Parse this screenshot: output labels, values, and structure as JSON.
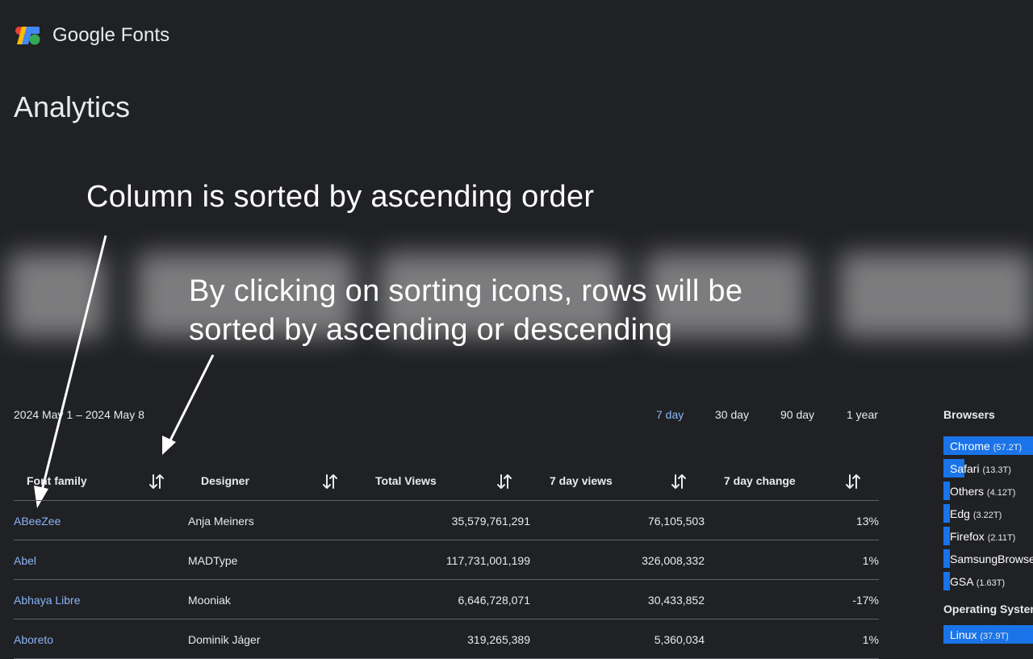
{
  "header": {
    "app_name": "Google Fonts"
  },
  "page": {
    "title": "Analytics"
  },
  "annotations": {
    "note1": "Column is sorted by ascending order",
    "note2": "By clicking on sorting icons, rows will be sorted by ascending or descending"
  },
  "filters": {
    "date_range": "2024 May 1 – 2024 May 8",
    "periods": [
      "7 day",
      "30 day",
      "90 day",
      "1 year"
    ],
    "active_period": "7 day"
  },
  "table": {
    "columns": [
      "Font family",
      "Designer",
      "Total Views",
      "7 day views",
      "7 day change"
    ],
    "sort_icon": "sort-arrows-icon",
    "rows": [
      {
        "family": "ABeeZee",
        "designer": "Anja Meiners",
        "total": "35,579,761,291",
        "week": "76,105,503",
        "change": "13%"
      },
      {
        "family": "Abel",
        "designer": "MADType",
        "total": "117,731,001,199",
        "week": "326,008,332",
        "change": "1%"
      },
      {
        "family": "Abhaya Libre",
        "designer": "Mooniak",
        "total": "6,646,728,071",
        "week": "30,433,852",
        "change": "-17%"
      },
      {
        "family": "Aboreto",
        "designer": "Dominik Jáger",
        "total": "319,265,389",
        "week": "5,360,034",
        "change": "1%"
      }
    ]
  },
  "browsers": {
    "title": "Browsers",
    "items": [
      {
        "name": "Chrome",
        "value": "(57.2T)",
        "share": 1.0
      },
      {
        "name": "Safari",
        "value": "(13.3T)",
        "share": 0.23
      },
      {
        "name": "Others",
        "value": "(4.12T)",
        "share": 0.072
      },
      {
        "name": "Edg",
        "value": "(3.22T)",
        "share": 0.056
      },
      {
        "name": "Firefox",
        "value": "(2.11T)",
        "share": 0.037
      },
      {
        "name": "SamsungBrowser",
        "value": "",
        "share": 0.025
      },
      {
        "name": "GSA",
        "value": "(1.63T)",
        "share": 0.028
      }
    ]
  },
  "os": {
    "title": "Operating Systems",
    "items": [
      {
        "name": "Linux",
        "value": "(37.9T)",
        "share": 1.0
      }
    ]
  },
  "colors": {
    "background": "#202124",
    "link": "#8ab4f8",
    "bar": "#1a73e8",
    "divider": "#5f6368"
  }
}
